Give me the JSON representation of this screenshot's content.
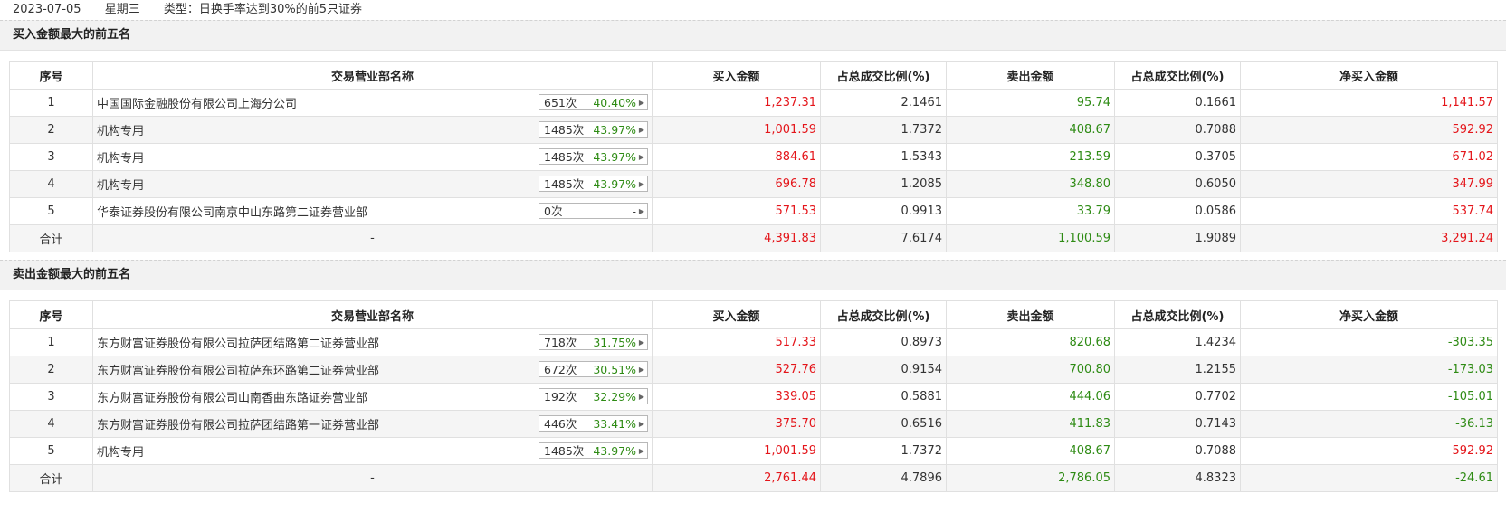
{
  "header": {
    "date": "2023-07-05",
    "weekday": "星期三",
    "type_text": "类型：日换手率达到30%的前5只证券"
  },
  "columns": [
    "序号",
    "交易营业部名称",
    "买入金额",
    "占总成交比例(%)",
    "卖出金额",
    "占总成交比例(%)",
    "净买入金额"
  ],
  "buy_section": {
    "title": "买入金额最大的前五名",
    "rows": [
      {
        "seq": "1",
        "name": "中国国际金融股份有限公司上海分公司",
        "count": "651次",
        "rate": "40.40%",
        "buy": "1,237.31",
        "buy_ratio": "2.1461",
        "sell": "95.74",
        "sell_ratio": "0.1661",
        "net": "1,141.57"
      },
      {
        "seq": "2",
        "name": "机构专用",
        "count": "1485次",
        "rate": "43.97%",
        "buy": "1,001.59",
        "buy_ratio": "1.7372",
        "sell": "408.67",
        "sell_ratio": "0.7088",
        "net": "592.92"
      },
      {
        "seq": "3",
        "name": "机构专用",
        "count": "1485次",
        "rate": "43.97%",
        "buy": "884.61",
        "buy_ratio": "1.5343",
        "sell": "213.59",
        "sell_ratio": "0.3705",
        "net": "671.02"
      },
      {
        "seq": "4",
        "name": "机构专用",
        "count": "1485次",
        "rate": "43.97%",
        "buy": "696.78",
        "buy_ratio": "1.2085",
        "sell": "348.80",
        "sell_ratio": "0.6050",
        "net": "347.99"
      },
      {
        "seq": "5",
        "name": "华泰证券股份有限公司南京中山东路第二证券营业部",
        "count": "0次",
        "rate": "-",
        "buy": "571.53",
        "buy_ratio": "0.9913",
        "sell": "33.79",
        "sell_ratio": "0.0586",
        "net": "537.74"
      }
    ],
    "total": {
      "label": "合计",
      "name": "-",
      "buy": "4,391.83",
      "buy_ratio": "7.6174",
      "sell": "1,100.59",
      "sell_ratio": "1.9089",
      "net": "3,291.24"
    }
  },
  "sell_section": {
    "title": "卖出金额最大的前五名",
    "rows": [
      {
        "seq": "1",
        "name": "东方财富证券股份有限公司拉萨团结路第二证券营业部",
        "count": "718次",
        "rate": "31.75%",
        "buy": "517.33",
        "buy_ratio": "0.8973",
        "sell": "820.68",
        "sell_ratio": "1.4234",
        "net": "-303.35"
      },
      {
        "seq": "2",
        "name": "东方财富证券股份有限公司拉萨东环路第二证券营业部",
        "count": "672次",
        "rate": "30.51%",
        "buy": "527.76",
        "buy_ratio": "0.9154",
        "sell": "700.80",
        "sell_ratio": "1.2155",
        "net": "-173.03"
      },
      {
        "seq": "3",
        "name": "东方财富证券股份有限公司山南香曲东路证券营业部",
        "count": "192次",
        "rate": "32.29%",
        "buy": "339.05",
        "buy_ratio": "0.5881",
        "sell": "444.06",
        "sell_ratio": "0.7702",
        "net": "-105.01"
      },
      {
        "seq": "4",
        "name": "东方财富证券股份有限公司拉萨团结路第一证券营业部",
        "count": "446次",
        "rate": "33.41%",
        "buy": "375.70",
        "buy_ratio": "0.6516",
        "sell": "411.83",
        "sell_ratio": "0.7143",
        "net": "-36.13"
      },
      {
        "seq": "5",
        "name": "机构专用",
        "count": "1485次",
        "rate": "43.97%",
        "buy": "1,001.59",
        "buy_ratio": "1.7372",
        "sell": "408.67",
        "sell_ratio": "0.7088",
        "net": "592.92"
      }
    ],
    "total": {
      "label": "合计",
      "name": "-",
      "buy": "2,761.44",
      "buy_ratio": "4.7896",
      "sell": "2,786.05",
      "sell_ratio": "4.8323",
      "net": "-24.61"
    }
  },
  "colors": {
    "positive": "#e4151a",
    "negative": "#2e8b14"
  },
  "icons": {
    "badge_arrow": "caret-right-icon"
  }
}
